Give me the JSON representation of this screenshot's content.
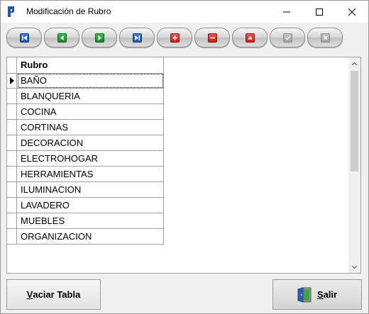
{
  "window": {
    "title": "Modificación de Rubro",
    "minimize_icon": "minimize-icon",
    "maximize_icon": "maximize-icon",
    "close_icon": "close-icon"
  },
  "toolbar": {
    "buttons": [
      {
        "name": "first-record-button",
        "icon": "skip-first-icon",
        "color": "#1d4fb0"
      },
      {
        "name": "prev-record-button",
        "icon": "arrow-left-icon",
        "color": "#16842a"
      },
      {
        "name": "next-record-button",
        "icon": "arrow-right-icon",
        "color": "#16842a"
      },
      {
        "name": "last-record-button",
        "icon": "skip-last-icon",
        "color": "#1d4fb0"
      },
      {
        "name": "insert-record-button",
        "icon": "plus-icon",
        "color": "#c81d1d"
      },
      {
        "name": "delete-record-button",
        "icon": "minus-icon",
        "color": "#c81d1d"
      },
      {
        "name": "edit-record-button",
        "icon": "triangle-up-icon",
        "color": "#c81d1d"
      },
      {
        "name": "post-record-button",
        "icon": "check-icon",
        "color": "#9e9e9e"
      },
      {
        "name": "cancel-record-button",
        "icon": "x-icon",
        "color": "#9e9e9e"
      }
    ]
  },
  "grid": {
    "column_header": "Rubro",
    "current_row_indicator": "current-row-arrow-icon",
    "rows": [
      "BAÑO",
      "BLANQUERIA",
      "COCINA",
      "CORTINAS",
      "DECORACION",
      "ELECTROHOGAR",
      "HERRAMIENTAS",
      "ILUMINACION",
      "LAVADERO",
      "MUEBLES",
      "ORGANIZACION"
    ]
  },
  "buttons": {
    "vaciar_prefix": "",
    "vaciar_hotkey": "V",
    "vaciar_rest": "aciar Tabla",
    "salir_hotkey": "S",
    "salir_rest": "alir",
    "salir_icon": "exit-door-icon"
  }
}
